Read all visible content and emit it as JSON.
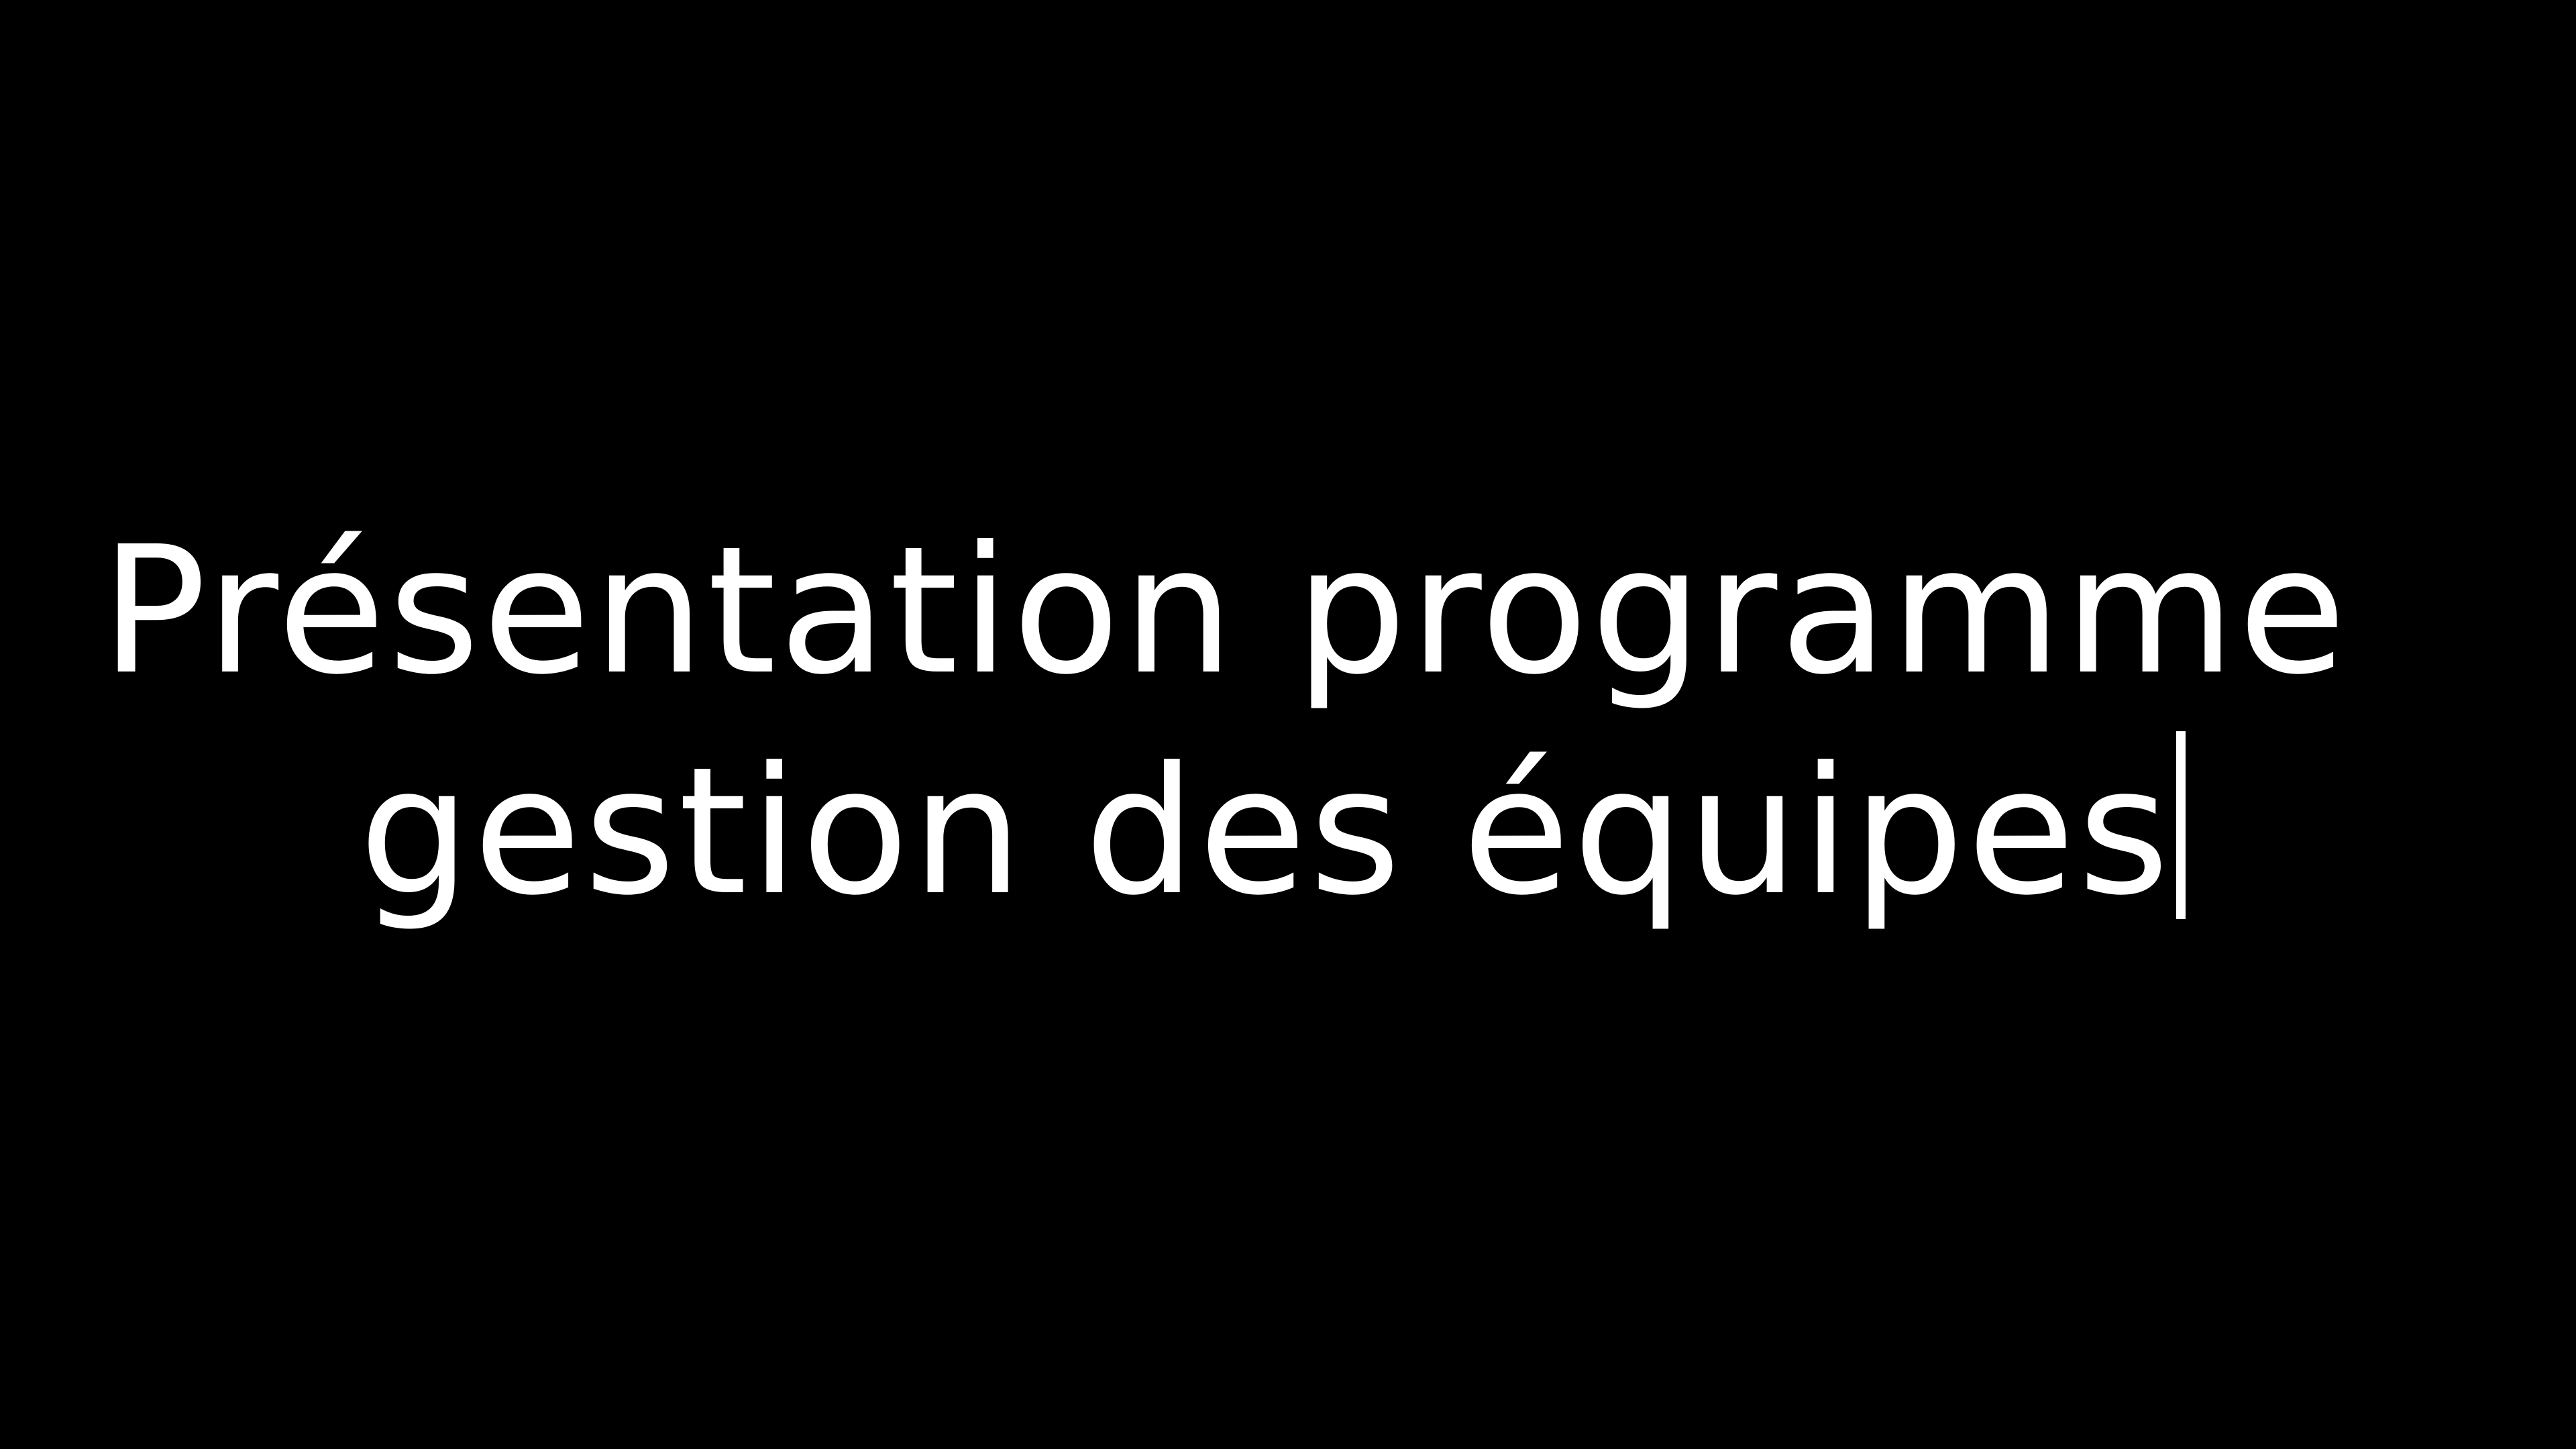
{
  "slide": {
    "background_color": "#000000",
    "text_color": "#ffffff",
    "title_line_1": "Présentation programme",
    "title_line_2": "gestion des équipes",
    "text_cursor_visible": true
  }
}
